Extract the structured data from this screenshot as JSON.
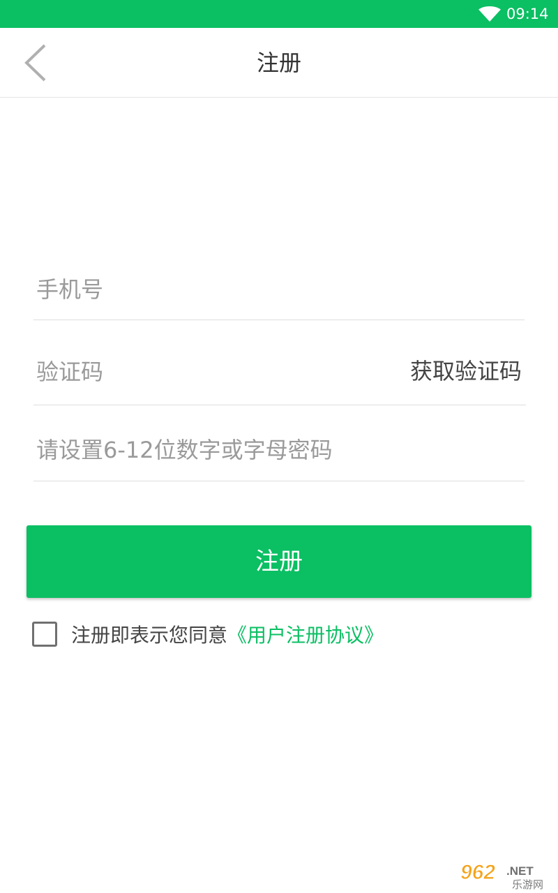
{
  "status_bar": {
    "time": "09:14",
    "background": "#0bbf63"
  },
  "header": {
    "title": "注册",
    "back_icon": "chevron-left-icon"
  },
  "form": {
    "phone_placeholder": "手机号",
    "code_placeholder": "验证码",
    "get_code_label": "获取验证码",
    "password_placeholder": "请设置6-12位数字或字母密码",
    "submit_label": "注册"
  },
  "agreement": {
    "text": "注册即表示您同意",
    "link_label": "《用户注册协议》",
    "checked": false
  },
  "watermark": {
    "brand": "962",
    "suffix": ".NET",
    "caption": "乐游网"
  },
  "colors": {
    "accent": "#0bbf63",
    "title_text": "#333333",
    "placeholder": "#9a9a9a"
  }
}
